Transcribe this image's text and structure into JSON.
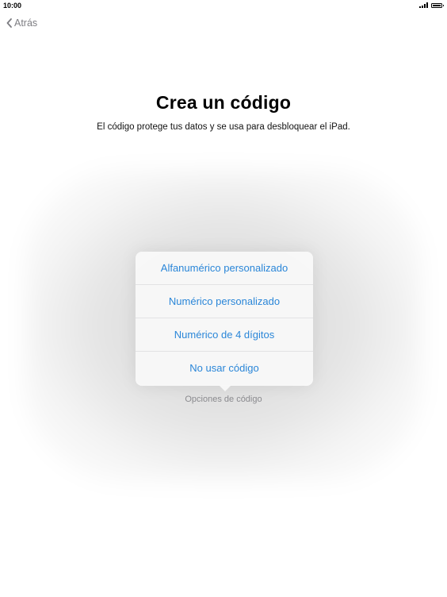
{
  "status_bar": {
    "time": "10:00"
  },
  "nav": {
    "back_label": "Atrás"
  },
  "header": {
    "title": "Crea un código",
    "subtitle": "El código protege tus datos y se usa para desbloquear el iPad."
  },
  "popover": {
    "options": [
      {
        "label": "Alfanumérico personalizado"
      },
      {
        "label": "Numérico personalizado"
      },
      {
        "label": "Numérico de 4 dígitos"
      },
      {
        "label": "No usar código"
      }
    ],
    "caption": "Opciones de código"
  },
  "colors": {
    "accent": "#2a86d8",
    "back_gray": "#7d7d82",
    "caption_gray": "#8a8a8e"
  },
  "icons": {
    "back": "chevron-left-icon",
    "signal": "signal-icon",
    "battery": "battery-icon"
  }
}
